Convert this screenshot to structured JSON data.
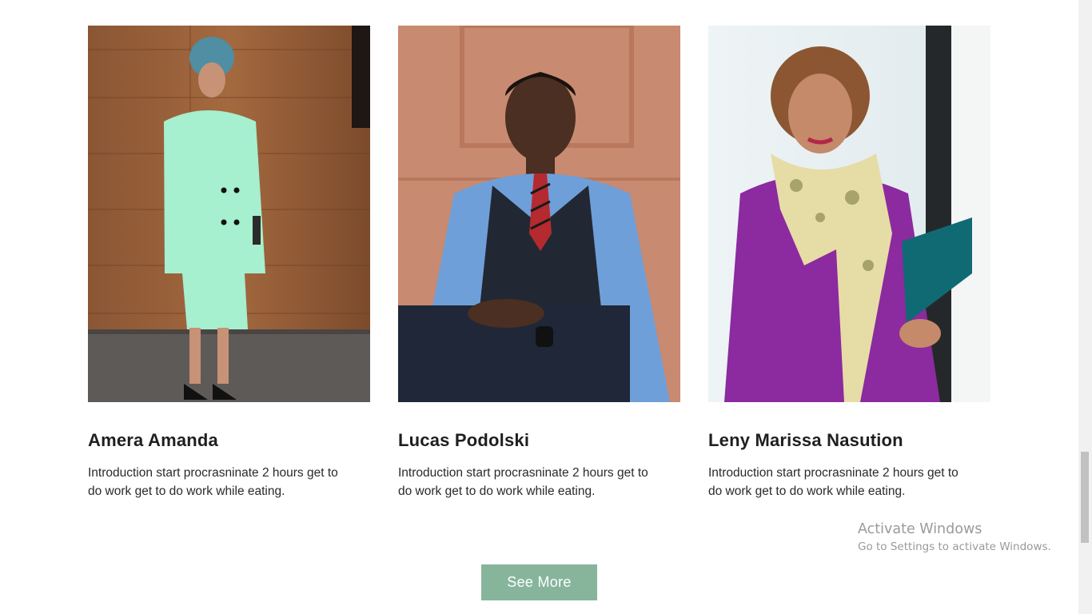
{
  "team": [
    {
      "name": "Amera Amanda",
      "intro": "Introduction start procrasninate 2 hours get to do work get to do work while eating."
    },
    {
      "name": "Lucas Podolski",
      "intro": "Introduction start procrasninate 2 hours get to do work get to do work while eating."
    },
    {
      "name": "Leny Marissa Nasution",
      "intro": "Introduction start procrasninate 2 hours get to do work get to do work while eating."
    }
  ],
  "see_more_label": "See More",
  "watermark": {
    "title": "Activate Windows",
    "subtitle": "Go to Settings to activate Windows."
  },
  "colors": {
    "button": "#86b59c",
    "heading": "#1f1f1f",
    "body_text": "#2a2a2a"
  }
}
